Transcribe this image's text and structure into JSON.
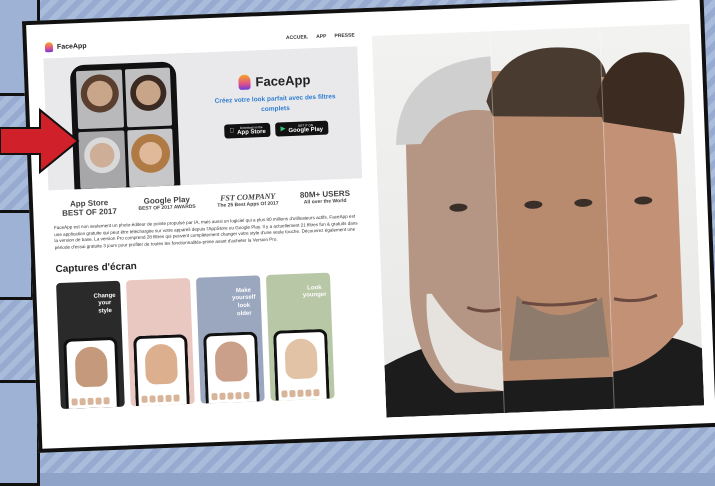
{
  "site": {
    "brand": "FaceApp",
    "nav": [
      "ACCUEIL",
      "APP",
      "PRESSE"
    ],
    "hero_title": "FaceApp",
    "tagline": "Créez votre look parfait avec des filtres complets",
    "appstore_small": "Download on the",
    "appstore": "App Store",
    "googleplay_small": "GET IT ON",
    "googleplay": "Google Play"
  },
  "awards": [
    {
      "line1": "App Store",
      "line2": "BEST OF 2017"
    },
    {
      "line1": "Google Play",
      "line2": "BEST OF 2017 AWARDS"
    },
    {
      "line1": "FST COMPANY",
      "line2": "The 25 Best Apps Of 2017"
    },
    {
      "line1": "80M+ USERS",
      "line2": "All over the World"
    }
  ],
  "description": "FaceApp est non seulement un photo-éditeur de pointe propulsé par IA, mais aussi un logiciel qui a plus 80 millions d'utilisateurs actifs. FaceApp est une application gratuite qui peut être téléchargée sur votre appareil depuis l'AppStore ou Google Play. Il y a actuellement 21 filtres fun & gratuits dans la version de base. La version Pro comprend 28 filtres qui peuvent complètement changer votre style d'une seule touche. Découvrez également une période d'essai gratuite 3 jours pour profiter de toutes les fonctionnalités-prime avant d'acheter la Version Pro.",
  "screenshots_title": "Captures d'écran",
  "shots": [
    {
      "caption": "Change your style"
    },
    {
      "caption": ""
    },
    {
      "caption": "Make yourself look older"
    },
    {
      "caption": "Look younger"
    }
  ],
  "colors": {
    "accent": "#2f7fd1",
    "arrow": "#d0202a",
    "background": "#8fa3c9"
  }
}
